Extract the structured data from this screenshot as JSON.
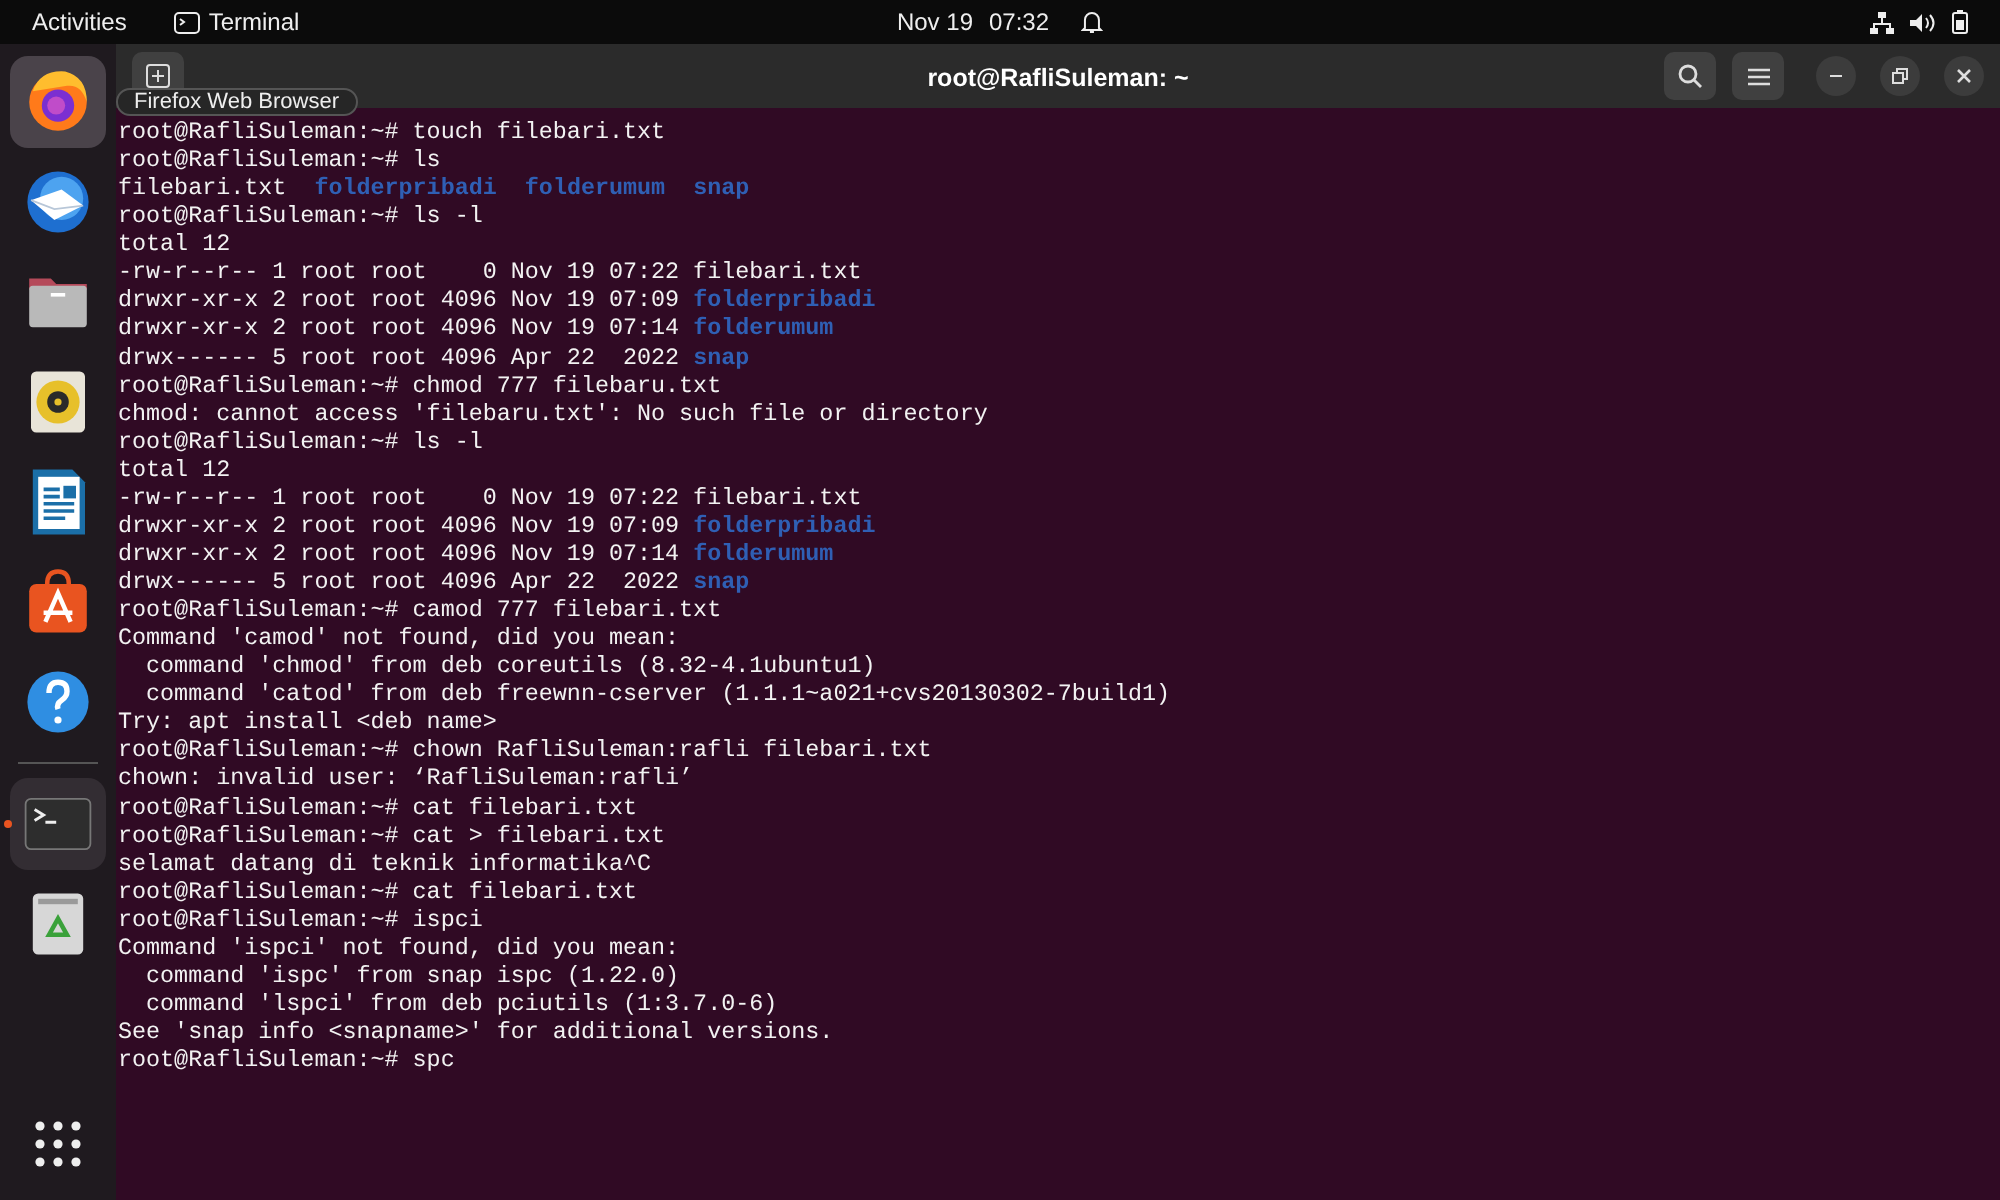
{
  "top_bar": {
    "activities": "Activities",
    "app_name": "Terminal",
    "date": "Nov 19",
    "time": "07:32"
  },
  "dock": [
    {
      "kind": "firefox",
      "hovered": true,
      "running": false
    },
    {
      "kind": "mail",
      "hovered": false,
      "running": false
    },
    {
      "kind": "files",
      "hovered": false,
      "running": false
    },
    {
      "kind": "music",
      "hovered": false,
      "running": false
    },
    {
      "kind": "writer",
      "hovered": false,
      "running": false
    },
    {
      "kind": "store",
      "hovered": false,
      "running": false
    },
    {
      "kind": "help",
      "hovered": false,
      "running": false
    },
    {
      "kind": "separator"
    },
    {
      "kind": "terminal",
      "hovered": false,
      "running": true
    },
    {
      "kind": "trash",
      "hovered": false,
      "running": false
    }
  ],
  "tooltip": "Firefox Web Browser",
  "window": {
    "title": "root@RafliSuleman: ~"
  },
  "terminal_lines": [
    [
      {
        "text": "root@RafliSuleman:~# touch filebari.txt",
        "kind": "plain"
      }
    ],
    [
      {
        "text": "root@RafliSuleman:~# ls",
        "kind": "plain"
      }
    ],
    [
      {
        "text": "filebari.txt  ",
        "kind": "plain"
      },
      {
        "text": "folderpribadi  ",
        "kind": "dir"
      },
      {
        "text": "folderumum  ",
        "kind": "dir"
      },
      {
        "text": "snap",
        "kind": "dir"
      }
    ],
    [
      {
        "text": "root@RafliSuleman:~# ls -l",
        "kind": "plain"
      }
    ],
    [
      {
        "text": "total 12",
        "kind": "plain"
      }
    ],
    [
      {
        "text": "-rw-r--r-- 1 root root    0 Nov 19 07:22 filebari.txt",
        "kind": "plain"
      }
    ],
    [
      {
        "text": "drwxr-xr-x 2 root root 4096 Nov 19 07:09 ",
        "kind": "plain"
      },
      {
        "text": "folderpribadi",
        "kind": "dir"
      }
    ],
    [
      {
        "text": "drwxr-xr-x 2 root root 4096 Nov 19 07:14 ",
        "kind": "plain"
      },
      {
        "text": "folderumum",
        "kind": "dir"
      }
    ],
    [
      {
        "text": "drwx------ 5 root root 4096 Apr 22  2022 ",
        "kind": "plain"
      },
      {
        "text": "snap",
        "kind": "dir"
      }
    ],
    [
      {
        "text": "root@RafliSuleman:~# chmod 777 filebaru.txt",
        "kind": "plain"
      }
    ],
    [
      {
        "text": "chmod: cannot access 'filebaru.txt': No such file or directory",
        "kind": "plain"
      }
    ],
    [
      {
        "text": "root@RafliSuleman:~# ls -l",
        "kind": "plain"
      }
    ],
    [
      {
        "text": "total 12",
        "kind": "plain"
      }
    ],
    [
      {
        "text": "-rw-r--r-- 1 root root    0 Nov 19 07:22 filebari.txt",
        "kind": "plain"
      }
    ],
    [
      {
        "text": "drwxr-xr-x 2 root root 4096 Nov 19 07:09 ",
        "kind": "plain"
      },
      {
        "text": "folderpribadi",
        "kind": "dir"
      }
    ],
    [
      {
        "text": "drwxr-xr-x 2 root root 4096 Nov 19 07:14 ",
        "kind": "plain"
      },
      {
        "text": "folderumum",
        "kind": "dir"
      }
    ],
    [
      {
        "text": "drwx------ 5 root root 4096 Apr 22  2022 ",
        "kind": "plain"
      },
      {
        "text": "snap",
        "kind": "dir"
      }
    ],
    [
      {
        "text": "root@RafliSuleman:~# camod 777 filebari.txt",
        "kind": "plain"
      }
    ],
    [
      {
        "text": "Command 'camod' not found, did you mean:",
        "kind": "plain"
      }
    ],
    [
      {
        "text": "  command 'chmod' from deb coreutils (8.32-4.1ubuntu1)",
        "kind": "plain"
      }
    ],
    [
      {
        "text": "  command 'catod' from deb freewnn-cserver (1.1.1~a021+cvs20130302-7build1)",
        "kind": "plain"
      }
    ],
    [
      {
        "text": "Try: apt install <deb name>",
        "kind": "plain"
      }
    ],
    [
      {
        "text": "root@RafliSuleman:~# chown RafliSuleman:rafli filebari.txt",
        "kind": "plain"
      }
    ],
    [
      {
        "text": "chown: invalid user: ‘RafliSuleman:rafli’",
        "kind": "plain"
      }
    ],
    [
      {
        "text": "root@RafliSuleman:~# cat filebari.txt",
        "kind": "plain"
      }
    ],
    [
      {
        "text": "root@RafliSuleman:~# cat > filebari.txt",
        "kind": "plain"
      }
    ],
    [
      {
        "text": "selamat datang di teknik informatika^C",
        "kind": "plain"
      }
    ],
    [
      {
        "text": "root@RafliSuleman:~# cat filebari.txt",
        "kind": "plain"
      }
    ],
    [
      {
        "text": "root@RafliSuleman:~# ispci",
        "kind": "plain"
      }
    ],
    [
      {
        "text": "Command 'ispci' not found, did you mean:",
        "kind": "plain"
      }
    ],
    [
      {
        "text": "  command 'ispc' from snap ispc (1.22.0)",
        "kind": "plain"
      }
    ],
    [
      {
        "text": "  command 'lspci' from deb pciutils (1:3.7.0-6)",
        "kind": "plain"
      }
    ],
    [
      {
        "text": "See 'snap info <snapname>' for additional versions.",
        "kind": "plain"
      }
    ],
    [
      {
        "text": "root@RafliSuleman:~# spc",
        "kind": "plain"
      }
    ]
  ]
}
